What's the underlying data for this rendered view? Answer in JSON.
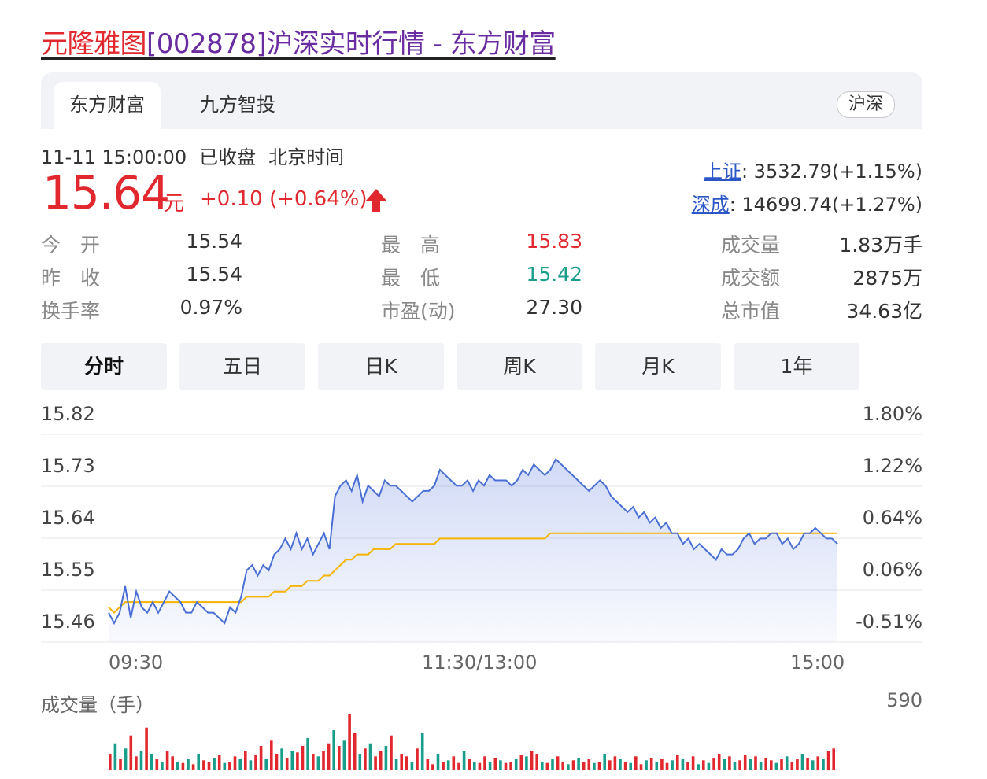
{
  "header": {
    "stock_name": "元隆雅图",
    "title_rest": "[002878]沪深实时行情 - 东方财富"
  },
  "source_tabs": [
    {
      "label": "东方财富",
      "active": true
    },
    {
      "label": "九方智投",
      "active": false
    }
  ],
  "market_toggle": "沪深",
  "status": {
    "datetime": "11-11 15:00:00",
    "state": "已收盘",
    "tz": "北京时间"
  },
  "quote": {
    "price": "15.64",
    "unit": "元",
    "change": "+0.10 (+0.64%)",
    "direction": "up"
  },
  "indices": [
    {
      "name": "上证",
      "value": ": 3532.79(+1.15%)"
    },
    {
      "name": "深成",
      "value": ": 14699.74(+1.27%)"
    }
  ],
  "stats": {
    "open_label": "今　开",
    "open": "15.54",
    "prev_label": "昨　收",
    "prev": "15.54",
    "turnover_label": "换手率",
    "turnover": "0.97%",
    "high_label": "最　高",
    "high": "15.83",
    "low_label": "最　低",
    "low": "15.42",
    "pe_label": "市盈(动)",
    "pe": "27.30",
    "vol_label": "成交量",
    "vol": "1.83万手",
    "amt_label": "成交额",
    "amt": "2875万",
    "cap_label": "总市值",
    "cap": "34.63亿"
  },
  "period_tabs": [
    {
      "label": "分时",
      "active": true
    },
    {
      "label": "五日",
      "active": false
    },
    {
      "label": "日K",
      "active": false
    },
    {
      "label": "周K",
      "active": false
    },
    {
      "label": "月K",
      "active": false
    },
    {
      "label": "1年",
      "active": false
    }
  ],
  "colors": {
    "up": "#e0282e",
    "down": "#1a9e8c",
    "price_line": "#4a6fd4",
    "avg_line": "#f5b400",
    "tab_bg": "#f1f3f6"
  },
  "chart_data": {
    "type": "line",
    "y_ticks_left": [
      "15.82",
      "15.73",
      "15.64",
      "15.55",
      "15.46"
    ],
    "y_ticks_right": [
      "1.80%",
      "1.22%",
      "0.64%",
      "0.06%",
      "-0.51%"
    ],
    "x_ticks": [
      "09:30",
      "11:30/13:00",
      "15:00"
    ],
    "ylim": [
      15.46,
      15.82
    ],
    "prev_close": 15.54,
    "series": [
      {
        "values": [
          15.48,
          15.46,
          15.48,
          15.53,
          15.47,
          15.52,
          15.49,
          15.48,
          15.5,
          15.48,
          15.5,
          15.52,
          15.51,
          15.5,
          15.48,
          15.48,
          15.5,
          15.49,
          15.48,
          15.48,
          15.47,
          15.46,
          15.49,
          15.48,
          15.51,
          15.56,
          15.57,
          15.55,
          15.57,
          15.56,
          15.59,
          15.6,
          15.62,
          15.6,
          15.63,
          15.6,
          15.62,
          15.59,
          15.61,
          15.63,
          15.6,
          15.7,
          15.72,
          15.73,
          15.71,
          15.74,
          15.69,
          15.72,
          15.71,
          15.7,
          15.73,
          15.72,
          15.72,
          15.71,
          15.7,
          15.69,
          15.7,
          15.71,
          15.71,
          15.72,
          15.75,
          15.74,
          15.73,
          15.72,
          15.72,
          15.73,
          15.71,
          15.73,
          15.72,
          15.74,
          15.73,
          15.73,
          15.73,
          15.72,
          15.73,
          15.75,
          15.74,
          15.76,
          15.75,
          15.74,
          15.75,
          15.77,
          15.76,
          15.75,
          15.74,
          15.73,
          15.72,
          15.71,
          15.72,
          15.73,
          15.72,
          15.7,
          15.69,
          15.68,
          15.67,
          15.68,
          15.66,
          15.67,
          15.65,
          15.66,
          15.64,
          15.65,
          15.63,
          15.63,
          15.61,
          15.62,
          15.6,
          15.61,
          15.6,
          15.59,
          15.58,
          15.6,
          15.59,
          15.59,
          15.6,
          15.62,
          15.63,
          15.61,
          15.62,
          15.62,
          15.63,
          15.63,
          15.61,
          15.62,
          15.6,
          15.61,
          15.63,
          15.63,
          15.64,
          15.63,
          15.62,
          15.62,
          15.61
        ]
      },
      {
        "values": [
          15.49,
          15.48,
          15.49,
          15.5,
          15.5,
          15.5,
          15.5,
          15.5,
          15.5,
          15.5,
          15.5,
          15.5,
          15.5,
          15.5,
          15.5,
          15.5,
          15.5,
          15.5,
          15.5,
          15.5,
          15.5,
          15.5,
          15.5,
          15.5,
          15.5,
          15.51,
          15.51,
          15.51,
          15.51,
          15.51,
          15.52,
          15.52,
          15.52,
          15.53,
          15.53,
          15.53,
          15.54,
          15.54,
          15.54,
          15.55,
          15.55,
          15.56,
          15.57,
          15.58,
          15.58,
          15.59,
          15.59,
          15.59,
          15.6,
          15.6,
          15.6,
          15.6,
          15.61,
          15.61,
          15.61,
          15.61,
          15.61,
          15.61,
          15.61,
          15.61,
          15.62,
          15.62,
          15.62,
          15.62,
          15.62,
          15.62,
          15.62,
          15.62,
          15.62,
          15.62,
          15.62,
          15.62,
          15.62,
          15.62,
          15.62,
          15.62,
          15.62,
          15.62,
          15.62,
          15.62,
          15.63,
          15.63,
          15.63,
          15.63,
          15.63,
          15.63,
          15.63,
          15.63,
          15.63,
          15.63,
          15.63,
          15.63,
          15.63,
          15.63,
          15.63,
          15.63,
          15.63,
          15.63,
          15.63,
          15.63,
          15.63,
          15.63,
          15.63,
          15.63,
          15.63,
          15.63,
          15.63,
          15.63,
          15.63,
          15.63,
          15.63,
          15.63,
          15.63,
          15.63,
          15.63,
          15.63,
          15.63,
          15.63,
          15.63,
          15.63,
          15.63,
          15.63,
          15.63,
          15.63,
          15.63,
          15.63,
          15.63,
          15.63,
          15.63,
          15.63,
          15.63,
          15.63,
          15.63
        ]
      }
    ],
    "grid": true
  },
  "volume_chart": {
    "type": "bar",
    "title": "成交量（手）",
    "max_label": "590",
    "max": 590,
    "bars": [
      60,
      100,
      40,
      80,
      130,
      50,
      70,
      160,
      60,
      40,
      30,
      70,
      50,
      30,
      25,
      40,
      20,
      60,
      35,
      30,
      45,
      55,
      25,
      30,
      50,
      40,
      70,
      35,
      55,
      90,
      40,
      110,
      60,
      80,
      45,
      70,
      65,
      90,
      120,
      60,
      50,
      70,
      100,
      150,
      90,
      110,
      210,
      140,
      60,
      80,
      100,
      50,
      70,
      90,
      130,
      40,
      60,
      50,
      30,
      80,
      140,
      40,
      20,
      60,
      30,
      35,
      50,
      25,
      70,
      40,
      30,
      25,
      50,
      30,
      45,
      35,
      25,
      30,
      40,
      55,
      50,
      70,
      60,
      30,
      25,
      40,
      50,
      30,
      20,
      35,
      45,
      30,
      40,
      25,
      30,
      60,
      35,
      50,
      40,
      30,
      25,
      50,
      20,
      35,
      45,
      30,
      40,
      25,
      35,
      55,
      40,
      30,
      50,
      20,
      35,
      25,
      45,
      60,
      40,
      50,
      30,
      35,
      55,
      40,
      50,
      30,
      45,
      35,
      25,
      40,
      50,
      30,
      40,
      60,
      45,
      35,
      50,
      40,
      70,
      80
    ],
    "bar_colors": [
      "r",
      "g",
      "r",
      "g",
      "r",
      "r",
      "g",
      "r",
      "g",
      "r",
      "g",
      "r",
      "r",
      "g",
      "r",
      "g",
      "r",
      "g",
      "r",
      "r",
      "g",
      "r",
      "g",
      "r",
      "r",
      "g",
      "r",
      "g",
      "r",
      "r",
      "g",
      "r",
      "r",
      "g",
      "r",
      "g",
      "r",
      "r",
      "g",
      "r",
      "g",
      "r",
      "r",
      "g",
      "r",
      "g",
      "r",
      "r",
      "g",
      "r",
      "g",
      "r",
      "r",
      "g",
      "r",
      "g",
      "r",
      "r",
      "g",
      "r",
      "g",
      "r",
      "r",
      "g",
      "r",
      "g",
      "r",
      "r",
      "g",
      "r",
      "g",
      "r",
      "r",
      "g",
      "r",
      "g",
      "r",
      "r",
      "g",
      "r",
      "g",
      "r",
      "r",
      "g",
      "r",
      "g",
      "r",
      "r",
      "g",
      "r",
      "g",
      "r",
      "r",
      "g",
      "r",
      "g",
      "r",
      "r",
      "g",
      "r",
      "g",
      "r",
      "r",
      "g",
      "r",
      "g",
      "r",
      "r",
      "g",
      "r",
      "g",
      "r",
      "r",
      "g",
      "r",
      "g",
      "r",
      "r",
      "g",
      "r",
      "g",
      "r",
      "r",
      "g",
      "r",
      "g",
      "r",
      "r",
      "g",
      "r",
      "g",
      "r",
      "r",
      "g",
      "r",
      "g",
      "r",
      "g",
      "r"
    ]
  }
}
